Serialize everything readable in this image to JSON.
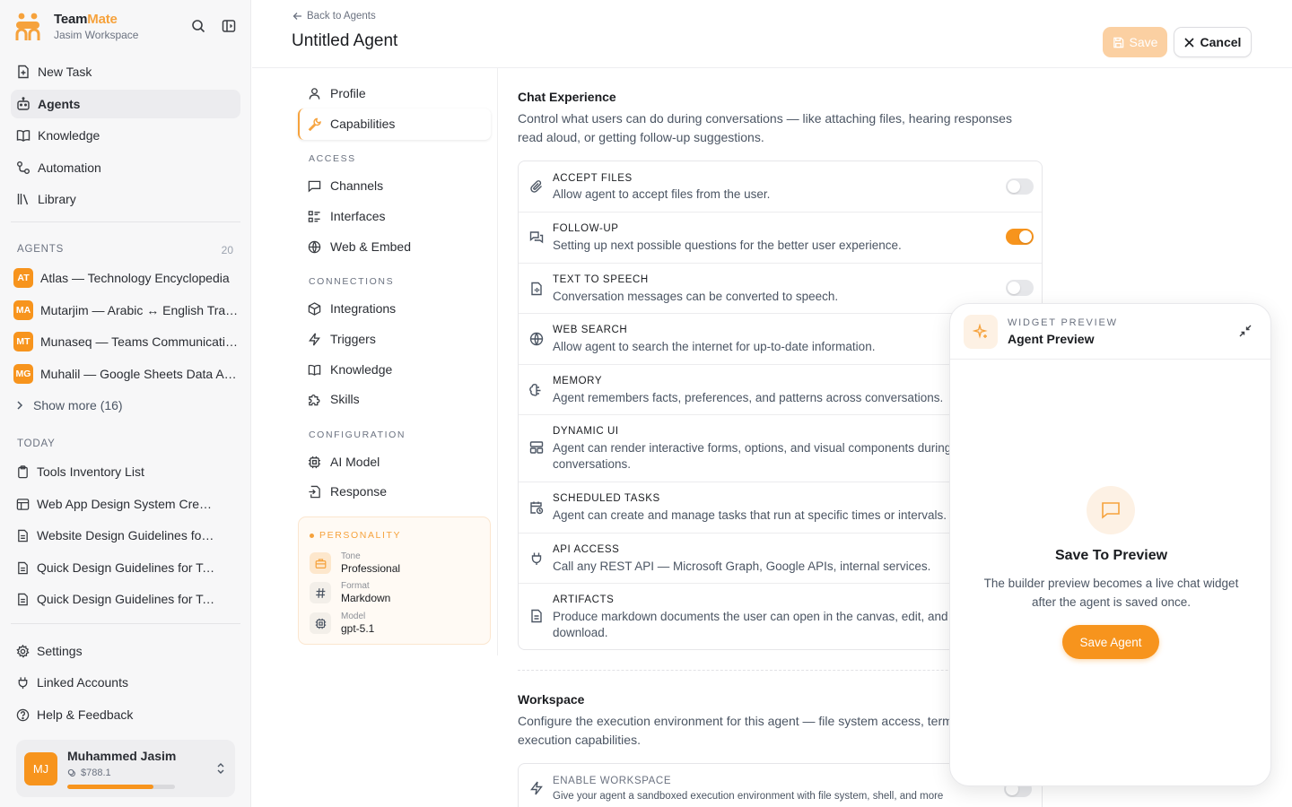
{
  "brand": {
    "name_prefix": "Team",
    "name_suffix": "Mate",
    "workspace": "Jasim Workspace"
  },
  "nav": [
    {
      "label": "New Task",
      "icon": "new-task-icon"
    },
    {
      "label": "Agents",
      "icon": "bot-icon",
      "active": true
    },
    {
      "label": "Knowledge",
      "icon": "book-icon"
    },
    {
      "label": "Automation",
      "icon": "automation-icon"
    },
    {
      "label": "Library",
      "icon": "library-icon"
    }
  ],
  "agents_section": {
    "label": "AGENTS",
    "count": "20"
  },
  "agents": [
    {
      "initials": "AT",
      "name": "Atlas — Technology Encyclopedia"
    },
    {
      "initials": "MA",
      "name": "Mutarjim — Arabic ↔ English Translator"
    },
    {
      "initials": "MT",
      "name": "Munaseq — Teams Communication Agent"
    },
    {
      "initials": "MG",
      "name": "Muhalil — Google Sheets Data Analyst"
    }
  ],
  "show_more": "Show more (16)",
  "today_label": "TODAY",
  "tasks": [
    {
      "name": "Tools Inventory List",
      "icon": "clipboard-icon"
    },
    {
      "name": "Web App Design System Creation",
      "icon": "layout-icon"
    },
    {
      "name": "Website Design Guidelines for Teams",
      "icon": "document-icon"
    },
    {
      "name": "Quick Design Guidelines for Teams",
      "icon": "document-icon"
    },
    {
      "name": "Quick Design Guidelines for Teams",
      "icon": "document-icon"
    }
  ],
  "bottom_nav": [
    {
      "label": "Settings",
      "icon": "gear-icon"
    },
    {
      "label": "Linked Accounts",
      "icon": "plug-icon"
    },
    {
      "label": "Help & Feedback",
      "icon": "help-icon"
    }
  ],
  "user": {
    "initials": "MJ",
    "name": "Muhammed Jasim",
    "credit": "$788.1",
    "credit_fraction": 0.8
  },
  "header": {
    "back": "Back to Agents",
    "title": "Untitled Agent",
    "save": "Save",
    "cancel": "Cancel"
  },
  "settings_nav": {
    "top": [
      {
        "label": "Profile",
        "icon": "user-icon"
      },
      {
        "label": "Capabilities",
        "icon": "wrench-icon",
        "active": true
      }
    ],
    "groups": [
      {
        "label": "ACCESS",
        "items": [
          {
            "label": "Channels",
            "icon": "message-square-icon"
          },
          {
            "label": "Interfaces",
            "icon": "list-icon"
          },
          {
            "label": "Web & Embed",
            "icon": "globe-icon"
          }
        ]
      },
      {
        "label": "CONNECTIONS",
        "items": [
          {
            "label": "Integrations",
            "icon": "box-icon"
          },
          {
            "label": "Triggers",
            "icon": "lightning-icon"
          },
          {
            "label": "Knowledge",
            "icon": "book-icon"
          },
          {
            "label": "Skills",
            "icon": "puzzle-icon"
          }
        ]
      },
      {
        "label": "CONFIGURATION",
        "items": [
          {
            "label": "AI Model",
            "icon": "cpu-icon"
          },
          {
            "label": "Response",
            "icon": "response-icon"
          }
        ]
      }
    ]
  },
  "personality": {
    "label": "PERSONALITY",
    "rows": [
      {
        "key": "Tone",
        "value": "Professional",
        "icon": "briefcase-icon"
      },
      {
        "key": "Format",
        "value": "Markdown",
        "icon": "hash-icon"
      },
      {
        "key": "Model",
        "value": "gpt-5.1",
        "icon": "cpu-icon"
      }
    ]
  },
  "chat_experience": {
    "title": "Chat Experience",
    "description": "Control what users can do during conversations — like attaching files, hearing responses read aloud, or getting follow-up suggestions.",
    "capabilities": [
      {
        "name": "ACCEPT FILES",
        "desc": "Allow agent to accept files from the user.",
        "icon": "paperclip-icon",
        "enabled": false
      },
      {
        "name": "FOLLOW-UP",
        "desc": "Setting up next possible questions for the better user experience.",
        "icon": "chat-bubbles-icon",
        "enabled": true
      },
      {
        "name": "TEXT TO SPEECH",
        "desc": "Conversation messages can be converted to speech.",
        "icon": "speech-file-icon",
        "enabled": false
      },
      {
        "name": "WEB SEARCH",
        "desc": "Allow agent to search the internet for up-to-date information.",
        "icon": "globe-icon",
        "enabled": false
      },
      {
        "name": "MEMORY",
        "desc": "Agent remembers facts, preferences, and patterns across conversations.",
        "icon": "brain-icon",
        "enabled": false
      },
      {
        "name": "DYNAMIC UI",
        "desc": "Agent can render interactive forms, options, and visual components during conversations.",
        "icon": "layout-icon",
        "enabled": false
      },
      {
        "name": "SCHEDULED TASKS",
        "desc": "Agent can create and manage tasks that run at specific times or intervals.",
        "icon": "calendar-clock-icon",
        "enabled": false
      },
      {
        "name": "API ACCESS",
        "desc": "Call any REST API — Microsoft Graph, Google APIs, internal services.",
        "icon": "plug-icon",
        "enabled": false
      },
      {
        "name": "ARTIFACTS",
        "desc": "Produce markdown documents the user can open in the canvas, edit, and download.",
        "icon": "document-icon",
        "enabled": false
      }
    ]
  },
  "workspace": {
    "title": "Workspace",
    "description": "Configure the execution environment for this agent — file system access, terminal, and code execution capabilities.",
    "capability": {
      "name": "ENABLE WORKSPACE",
      "desc": "Give your agent a sandboxed execution environment with file system, shell, and more",
      "icon": "lightning-icon",
      "enabled": false
    }
  },
  "preview": {
    "label": "WIDGET PREVIEW",
    "title": "Agent Preview",
    "heading": "Save To Preview",
    "text": "The builder preview becomes a live chat widget after the agent is saved once.",
    "button": "Save Agent"
  },
  "colors": {
    "accent": "#f7941d",
    "accent_soft": "#fbd0a2",
    "brand_mate": "#f6a23c"
  }
}
